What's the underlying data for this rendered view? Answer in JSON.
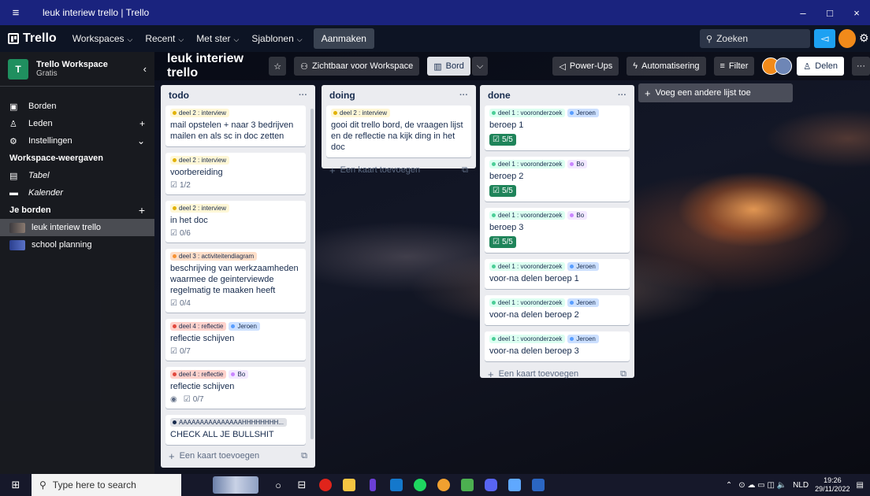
{
  "window": {
    "title": "leuk interiew trello | Trello",
    "menu_icon": "hamburger-icon",
    "controls": [
      "–",
      "□",
      "×"
    ]
  },
  "appbar": {
    "logo": "Trello",
    "nav": [
      {
        "label": "Workspaces"
      },
      {
        "label": "Recent"
      },
      {
        "label": "Met ster"
      },
      {
        "label": "Sjablonen"
      }
    ],
    "create": "Aanmaken",
    "search_placeholder": "Zoeken"
  },
  "sidebar": {
    "workspace_initial": "T",
    "workspace_name": "Trello Workspace",
    "workspace_plan": "Gratis",
    "items": [
      {
        "label": "Borden",
        "icon": "board-icon"
      },
      {
        "label": "Leden",
        "icon": "person-icon",
        "action": "+"
      },
      {
        "label": "Instellingen",
        "icon": "gear-icon",
        "action": "⌄"
      }
    ],
    "views_heading": "Workspace-weergaven",
    "views": [
      {
        "label": "Tabel",
        "icon": "table-icon"
      },
      {
        "label": "Kalender",
        "icon": "calendar-icon"
      }
    ],
    "boards_heading": "Je borden",
    "boards_action": "+",
    "boards": [
      {
        "label": "leuk interiew trello",
        "active": true
      },
      {
        "label": "school planning",
        "active": false
      }
    ]
  },
  "board": {
    "title": "leuk interiew trello",
    "visibility": "Zichtbaar voor Workspace",
    "view": "Bord",
    "powerups": "Power-Ups",
    "automation": "Automatisering",
    "filter": "Filter",
    "share": "Delen",
    "more": "···",
    "add_list": "Voeg een andere lijst toe",
    "add_card": "Een kaart toevoegen"
  },
  "lists": {
    "todo": {
      "title": "todo",
      "cards": [
        {
          "labels": [
            {
              "text": "deel 2 : interview",
              "color": "yellow"
            }
          ],
          "title": "mail opstelen + naar 3 bedrijven mailen en als sc in doc zetten",
          "checklist": ""
        },
        {
          "labels": [
            {
              "text": "deel 2 : interview",
              "color": "yellow"
            }
          ],
          "title": "voorbereiding",
          "checklist": "1/2"
        },
        {
          "labels": [
            {
              "text": "deel 2 : interview",
              "color": "yellow"
            }
          ],
          "title": "in het doc",
          "checklist": "0/6"
        },
        {
          "labels": [
            {
              "text": "deel 3 : activiteitendiagram",
              "color": "orange"
            }
          ],
          "title": "beschrijving van werkzaamheden waarmee de geinterviewde regelmatig te maaken heeft",
          "checklist": "0/4"
        },
        {
          "labels": [
            {
              "text": "deel 4 : reflectie",
              "color": "red"
            },
            {
              "text": "Jeroen",
              "color": "blue"
            }
          ],
          "title": "reflectie schijven",
          "checklist": "0/7"
        },
        {
          "labels": [
            {
              "text": "deel 4 : reflectie",
              "color": "red"
            },
            {
              "text": "Bo",
              "color": "purple"
            }
          ],
          "title": "reflectie schijven",
          "checklist": "0/7"
        },
        {
          "labels": [
            {
              "text": "AAAAAAAAAAAAAAAHHHHHHHH...",
              "color": "dark"
            }
          ],
          "title": "CHECK ALL JE BULLSHIT",
          "checklist": ""
        }
      ]
    },
    "doing": {
      "title": "doing",
      "cards": [
        {
          "labels": [
            {
              "text": "deel 2 : interview",
              "color": "yellow"
            }
          ],
          "title": "gooi dit trello bord, de vraagen lijst en de reflectie na kijk ding in het doc",
          "checklist": ""
        }
      ]
    },
    "done": {
      "title": "done",
      "cards": [
        {
          "labels": [
            {
              "text": "deel 1 : vooronderzoek",
              "color": "green"
            },
            {
              "text": "Jeroen",
              "color": "blue"
            }
          ],
          "title": "beroep 1",
          "checklist": "5/5"
        },
        {
          "labels": [
            {
              "text": "deel 1 : vooronderzoek",
              "color": "green"
            },
            {
              "text": "Bo",
              "color": "purple"
            }
          ],
          "title": "beroep 2",
          "checklist": "5/5"
        },
        {
          "labels": [
            {
              "text": "deel 1 : vooronderzoek",
              "color": "green"
            },
            {
              "text": "Bo",
              "color": "purple"
            }
          ],
          "title": "beroep 3",
          "checklist": "5/5"
        },
        {
          "labels": [
            {
              "text": "deel 1 : vooronderzoek",
              "color": "green"
            },
            {
              "text": "Jeroen",
              "color": "blue"
            }
          ],
          "title": "voor-na delen beroep 1",
          "checklist": ""
        },
        {
          "labels": [
            {
              "text": "deel 1 : vooronderzoek",
              "color": "green"
            },
            {
              "text": "Jeroen",
              "color": "blue"
            }
          ],
          "title": "voor-na delen beroep 2",
          "checklist": ""
        },
        {
          "labels": [
            {
              "text": "deel 1 : vooronderzoek",
              "color": "green"
            },
            {
              "text": "Jeroen",
              "color": "blue"
            }
          ],
          "title": "voor-na delen beroep 3",
          "checklist": ""
        }
      ]
    }
  },
  "taskbar": {
    "search_placeholder": "Type here to search",
    "language": "NLD",
    "time": "19:26",
    "date": "29/11/2022"
  }
}
